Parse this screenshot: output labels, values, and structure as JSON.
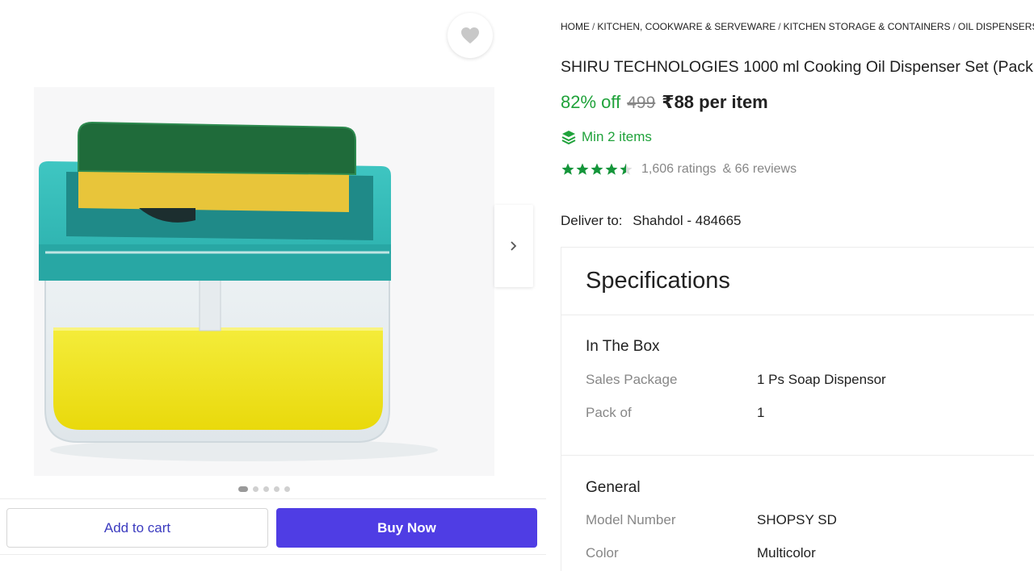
{
  "breadcrumb": {
    "items": [
      "HOME",
      "KITCHEN, COOKWARE & SERVEWARE",
      "KITCHEN STORAGE & CONTAINERS",
      "OIL DISPENSERS"
    ]
  },
  "product": {
    "title": "SHIRU TECHNOLOGIES 1000 ml Cooking Oil Dispenser Set (Pack",
    "discount": "82% off",
    "mrp": "499",
    "price": "₹88 per item",
    "min_items": "Min 2 items",
    "rating_value": 4.5,
    "ratings_text": "1,606 ratings",
    "reviews_text": "& 66 reviews"
  },
  "delivery": {
    "label": "Deliver to:",
    "location": "Shahdol - 484665"
  },
  "gallery": {
    "active_index": 0,
    "total": 5
  },
  "actions": {
    "add_to_cart": "Add to cart",
    "buy_now": "Buy Now"
  },
  "specifications": {
    "heading": "Specifications",
    "groups": [
      {
        "title": "In The Box",
        "rows": [
          {
            "key": "Sales Package",
            "value": "1 Ps Soap Dispensor"
          },
          {
            "key": "Pack of",
            "value": "1"
          }
        ]
      },
      {
        "title": "General",
        "rows": [
          {
            "key": "Model Number",
            "value": "SHOPSY SD"
          },
          {
            "key": "Color",
            "value": "Multicolor"
          }
        ]
      }
    ]
  },
  "icons": {
    "wishlist": "heart-icon",
    "next": "chevron-right-icon",
    "min_items": "stack-icon",
    "rating": "star-icon"
  },
  "colors": {
    "accent": "#4f3de4",
    "success": "#1fa23a",
    "muted": "#878787"
  }
}
